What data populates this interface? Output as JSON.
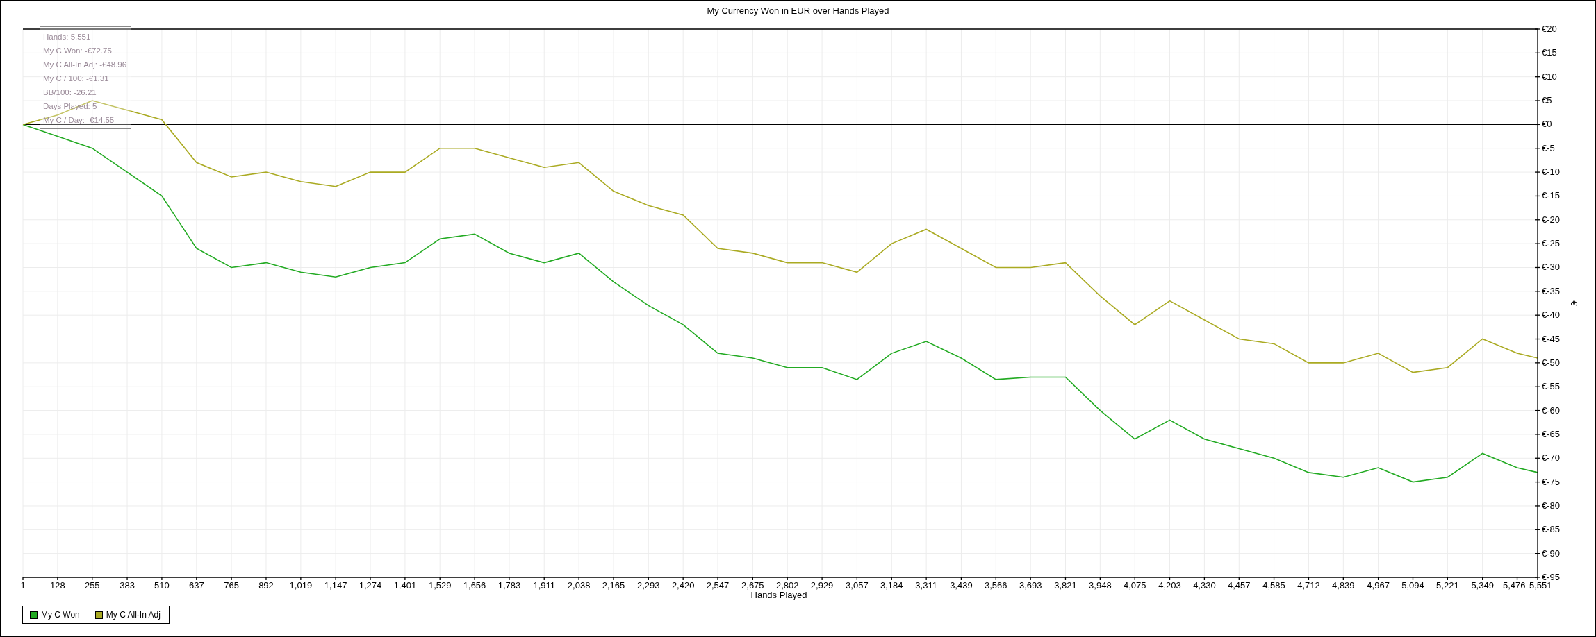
{
  "chart": {
    "tooltip": [
      "Hands: 5,551",
      "My C Won: -€72.75",
      "My C All-In Adj: -€48.96",
      "My C / 100: -€1.31",
      "BB/100: -26.21",
      "Days Played: 5",
      "My C / Day: -€14.55"
    ],
    "chart_data": {
      "type": "line",
      "title": "My Currency Won in EUR over Hands Played",
      "xlabel": "Hands Played",
      "ylabel": "€",
      "x": [
        1,
        128,
        255,
        383,
        510,
        637,
        765,
        892,
        1019,
        1147,
        1274,
        1401,
        1529,
        1656,
        1783,
        1911,
        2038,
        2165,
        2293,
        2420,
        2547,
        2675,
        2802,
        2929,
        3057,
        3184,
        3311,
        3439,
        3566,
        3693,
        3821,
        3948,
        4075,
        4203,
        4330,
        4457,
        4585,
        4712,
        4839,
        4967,
        5094,
        5221,
        5349,
        5476,
        5551
      ],
      "series": [
        {
          "name": "My C Won",
          "color": "#22aa22",
          "values": [
            0,
            -2.5,
            -5,
            -10,
            -15,
            -26,
            -30,
            -29,
            -31,
            -32,
            -30,
            -29,
            -24,
            -23,
            -27,
            -29,
            -27,
            -33,
            -38,
            -42,
            -48,
            -49,
            -51,
            -51,
            -53.5,
            -48,
            -45.5,
            -49,
            -53.5,
            -53,
            -53,
            -60,
            -66,
            -62,
            -66,
            -68,
            -70,
            -73,
            -74,
            -72,
            -75,
            -74,
            -69,
            -72,
            -73
          ]
        },
        {
          "name": "My C All-In Adj",
          "color": "#aaaa22",
          "values": [
            0,
            2,
            5,
            3,
            1,
            -8,
            -11,
            -10,
            -12,
            -13,
            -10,
            -10,
            -5,
            -5,
            -7,
            -9,
            -8,
            -14,
            -17,
            -19,
            -26,
            -27,
            -29,
            -29,
            -31,
            -25,
            -22,
            -26,
            -30,
            -30,
            -29,
            -36,
            -42,
            -37,
            -41,
            -45,
            -46,
            -50,
            -50,
            -48,
            -52,
            -51,
            -45,
            -48,
            -49
          ]
        }
      ],
      "grid": true,
      "xlim": [
        1,
        5551
      ],
      "ylim": [
        -95,
        20
      ],
      "xticks": [
        {
          "value": 1,
          "label": "1"
        },
        {
          "value": 128,
          "label": "128"
        },
        {
          "value": 255,
          "label": "255"
        },
        {
          "value": 383,
          "label": "383"
        },
        {
          "value": 510,
          "label": "510"
        },
        {
          "value": 637,
          "label": "637"
        },
        {
          "value": 765,
          "label": "765"
        },
        {
          "value": 892,
          "label": "892"
        },
        {
          "value": 1019,
          "label": "1,019"
        },
        {
          "value": 1147,
          "label": "1,147"
        },
        {
          "value": 1274,
          "label": "1,274"
        },
        {
          "value": 1401,
          "label": "1,401"
        },
        {
          "value": 1529,
          "label": "1,529"
        },
        {
          "value": 1656,
          "label": "1,656"
        },
        {
          "value": 1783,
          "label": "1,783"
        },
        {
          "value": 1911,
          "label": "1,911"
        },
        {
          "value": 2038,
          "label": "2,038"
        },
        {
          "value": 2165,
          "label": "2,165"
        },
        {
          "value": 2293,
          "label": "2,293"
        },
        {
          "value": 2420,
          "label": "2,420"
        },
        {
          "value": 2547,
          "label": "2,547"
        },
        {
          "value": 2675,
          "label": "2,675"
        },
        {
          "value": 2802,
          "label": "2,802"
        },
        {
          "value": 2929,
          "label": "2,929"
        },
        {
          "value": 3057,
          "label": "3,057"
        },
        {
          "value": 3184,
          "label": "3,184"
        },
        {
          "value": 3311,
          "label": "3,311"
        },
        {
          "value": 3439,
          "label": "3,439"
        },
        {
          "value": 3566,
          "label": "3,566"
        },
        {
          "value": 3693,
          "label": "3,693"
        },
        {
          "value": 3821,
          "label": "3,821"
        },
        {
          "value": 3948,
          "label": "3,948"
        },
        {
          "value": 4075,
          "label": "4,075"
        },
        {
          "value": 4203,
          "label": "4,203"
        },
        {
          "value": 4330,
          "label": "4,330"
        },
        {
          "value": 4457,
          "label": "4,457"
        },
        {
          "value": 4585,
          "label": "4,585"
        },
        {
          "value": 4712,
          "label": "4,712"
        },
        {
          "value": 4839,
          "label": "4,839"
        },
        {
          "value": 4967,
          "label": "4,967"
        },
        {
          "value": 5094,
          "label": "5,094"
        },
        {
          "value": 5221,
          "label": "5,221"
        },
        {
          "value": 5349,
          "label": "5,349"
        },
        {
          "value": 5476,
          "label": "5,476"
        },
        {
          "value": 5551,
          "label": "5,551"
        }
      ],
      "yticks": [
        {
          "value": 20,
          "label": "€20"
        },
        {
          "value": 15,
          "label": "€15"
        },
        {
          "value": 10,
          "label": "€10"
        },
        {
          "value": 5,
          "label": "€5"
        },
        {
          "value": 0,
          "label": "€0"
        },
        {
          "value": -5,
          "label": "€-5"
        },
        {
          "value": -10,
          "label": "€-10"
        },
        {
          "value": -15,
          "label": "€-15"
        },
        {
          "value": -20,
          "label": "€-20"
        },
        {
          "value": -25,
          "label": "€-25"
        },
        {
          "value": -30,
          "label": "€-30"
        },
        {
          "value": -35,
          "label": "€-35"
        },
        {
          "value": -40,
          "label": "€-40"
        },
        {
          "value": -45,
          "label": "€-45"
        },
        {
          "value": -50,
          "label": "€-50"
        },
        {
          "value": -55,
          "label": "€-55"
        },
        {
          "value": -60,
          "label": "€-60"
        },
        {
          "value": -65,
          "label": "€-65"
        },
        {
          "value": -70,
          "label": "€-70"
        },
        {
          "value": -75,
          "label": "€-75"
        },
        {
          "value": -80,
          "label": "€-80"
        },
        {
          "value": -85,
          "label": "€-85"
        },
        {
          "value": -90,
          "label": "€-90"
        },
        {
          "value": -95,
          "label": "€-95"
        }
      ]
    }
  }
}
